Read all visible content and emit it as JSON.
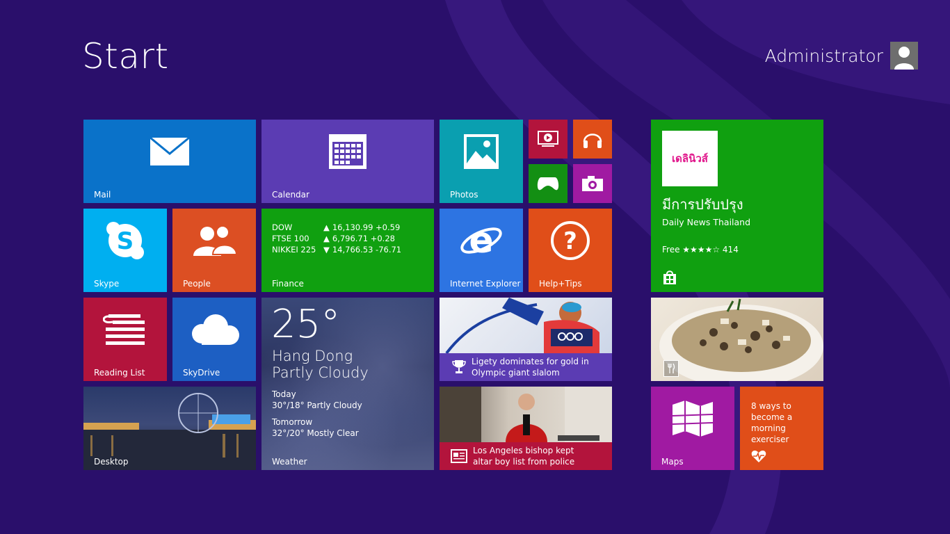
{
  "page": {
    "title": "Start"
  },
  "user": {
    "name": "Administrator",
    "icon": "user-icon"
  },
  "tiles": {
    "mail": {
      "label": "Mail",
      "color": "#0a72c9",
      "icon": "envelope-icon"
    },
    "calendar": {
      "label": "Calendar",
      "color": "#5b3cb3",
      "icon": "calendar-icon"
    },
    "photos": {
      "label": "Photos",
      "color": "#0a9fb0",
      "icon": "picture-icon"
    },
    "video": {
      "color": "#b3143c",
      "icon": "video-icon"
    },
    "music": {
      "color": "#e04e19",
      "icon": "headphones-icon"
    },
    "games": {
      "color": "#138f13",
      "icon": "gamepad-icon"
    },
    "camera": {
      "color": "#a01aa2",
      "icon": "camera-icon"
    },
    "store_app": {
      "color": "#10a010",
      "logo_text": "เดลินิวส์",
      "title": "มีการปรับปรุง",
      "subtitle": "Daily News Thailand",
      "price": "Free",
      "stars": "★★★★☆",
      "rating_count": "414",
      "icon": "store-bag-icon"
    },
    "skype": {
      "label": "Skype",
      "color": "#00aff0",
      "icon": "skype-icon"
    },
    "people": {
      "label": "People",
      "color": "#dc4f23",
      "icon": "people-icon"
    },
    "finance": {
      "label": "Finance",
      "color": "#10a010",
      "rows": [
        {
          "name": "DOW",
          "dir": "▲",
          "value": "16,130.99 +0.59"
        },
        {
          "name": "FTSE 100",
          "dir": "▲",
          "value": "6,796.71 +0.28"
        },
        {
          "name": "NIKKEI 225",
          "dir": "▼",
          "value": "14,766.53 -76.71"
        }
      ]
    },
    "ie": {
      "label": "Internet Explorer",
      "color": "#2d74e2",
      "icon": "ie-icon"
    },
    "help": {
      "label": "Help+Tips",
      "color": "#e04e19",
      "icon": "question-icon"
    },
    "reading_list": {
      "label": "Reading List",
      "color": "#b3143c",
      "icon": "reading-list-icon"
    },
    "skydrive": {
      "label": "SkyDrive",
      "color": "#1d5fc3",
      "icon": "cloud-icon"
    },
    "weather": {
      "label": "Weather",
      "temp": "25°",
      "city": "Hang Dong",
      "condition": "Partly Cloudy",
      "today_label": "Today",
      "today": "30°/18° Partly Cloudy",
      "tomorrow_label": "Tomorrow",
      "tomorrow": "32°/20° Mostly Clear"
    },
    "sports": {
      "headline": "Ligety dominates for gold in Olympic giant slalom",
      "color": "#5b3cb3",
      "icon": "trophy-icon"
    },
    "news": {
      "headline": "Los Angeles bishop kept altar boy list from police",
      "color": "#b3143c",
      "icon": "newspaper-icon"
    },
    "food": {
      "icon": "fork-knife-icon"
    },
    "desktop": {
      "label": "Desktop"
    },
    "maps": {
      "label": "Maps",
      "color": "#a01aa2",
      "icon": "map-icon"
    },
    "health": {
      "text": "8 ways to become a morning exerciser",
      "color": "#e04e19",
      "icon": "heart-pulse-icon"
    }
  }
}
